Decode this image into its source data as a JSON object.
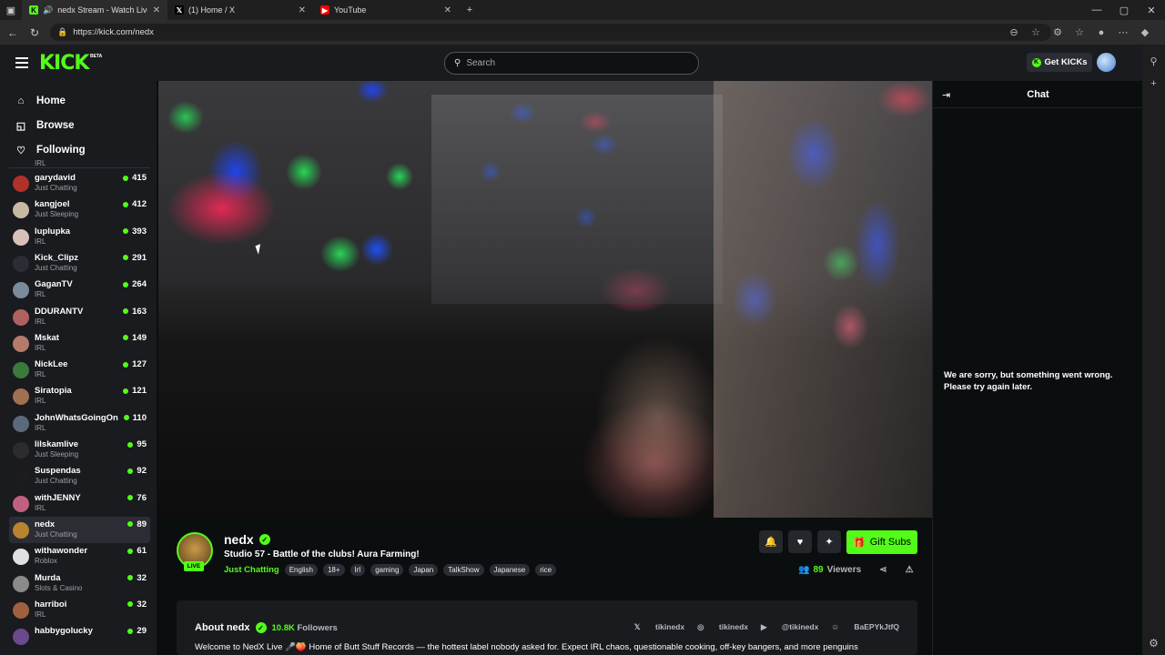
{
  "browser": {
    "tabs": [
      {
        "title": "nedx Stream - Watch Live on Kick",
        "icon": "kick-k"
      },
      {
        "title": "(1) Home / X",
        "icon": "x-logo"
      },
      {
        "title": "YouTube",
        "icon": "youtube-logo"
      }
    ],
    "new_tab": "+",
    "url": "https://kick.com/nedx",
    "window_controls": [
      "—",
      "▢",
      "✕"
    ]
  },
  "header": {
    "logo": "KICK",
    "beta": "BETA",
    "search_placeholder": "Search",
    "get_kicks": "Get KICKs"
  },
  "sidebar": {
    "nav": [
      {
        "label": "Home",
        "icon": "home-icon"
      },
      {
        "label": "Browse",
        "icon": "browse-icon"
      },
      {
        "label": "Following",
        "icon": "heart-icon"
      }
    ],
    "top_partial_category": "IRL",
    "channels": [
      {
        "name": "garydavid",
        "category": "Just Chatting",
        "viewers": "415",
        "color": "#b0302a"
      },
      {
        "name": "kangjoel",
        "category": "Just Sleeping",
        "viewers": "412",
        "color": "#c7b9a4"
      },
      {
        "name": "luplupka",
        "category": "IRL",
        "viewers": "393",
        "color": "#d8c0b8"
      },
      {
        "name": "Kick_Clipz",
        "category": "Just Chatting",
        "viewers": "291",
        "color": "#2a2d33"
      },
      {
        "name": "GaganTV",
        "category": "IRL",
        "viewers": "264",
        "color": "#7a8b9a"
      },
      {
        "name": "DDURANTV",
        "category": "IRL",
        "viewers": "163",
        "color": "#b06060"
      },
      {
        "name": "Mskat",
        "category": "IRL",
        "viewers": "149",
        "color": "#b57a6a"
      },
      {
        "name": "NickLee",
        "category": "IRL",
        "viewers": "127",
        "color": "#3a7a3a"
      },
      {
        "name": "Siratopia",
        "category": "IRL",
        "viewers": "121",
        "color": "#a07050"
      },
      {
        "name": "JohnWhatsGoingOn",
        "category": "IRL",
        "viewers": "110",
        "color": "#5a6a7a"
      },
      {
        "name": "lilskamlive",
        "category": "Just Sleeping",
        "viewers": "95",
        "color": "#2c2c2c"
      },
      {
        "name": "Suspendas",
        "category": "Just Chatting",
        "viewers": "92",
        "color": "#1c1c1c"
      },
      {
        "name": "withJENNY",
        "category": "IRL",
        "viewers": "76",
        "color": "#c06080"
      },
      {
        "name": "nedx",
        "category": "Just Chatting",
        "viewers": "89",
        "color": "#b8842e"
      },
      {
        "name": "withawonder",
        "category": "Roblox",
        "viewers": "61",
        "color": "#e0e0e0"
      },
      {
        "name": "Murda",
        "category": "Slots & Casino",
        "viewers": "32",
        "color": "#8a8a8a"
      },
      {
        "name": "harriboi",
        "category": "IRL",
        "viewers": "32",
        "color": "#a06040"
      },
      {
        "name": "habbygolucky",
        "category": "",
        "viewers": "29",
        "color": "#6a4a8a"
      }
    ],
    "selected_channel": "nedx"
  },
  "stream": {
    "channel_name": "nedx",
    "live_badge": "LIVE",
    "title": "Studio 57 - Battle of the clubs! Aura Farming!",
    "category": "Just Chatting",
    "tags": [
      "English",
      "18+",
      "Irl",
      "gaming",
      "Japan",
      "TalkShow",
      "Japanese",
      "rice"
    ],
    "gift_subs": "Gift Subs",
    "viewer_count": "89",
    "viewers_label": "Viewers"
  },
  "about": {
    "title": "About nedx",
    "followers_count": "10.8K",
    "followers_label": "Followers",
    "socials": [
      "tikinedx",
      "tikinedx",
      "@tikinedx",
      "BaEPYkJtfQ"
    ],
    "description": "Welcome to NedX Live 🎤🍑 Home of Butt Stuff Records — the hottest label nobody asked for. Expect IRL chaos, questionable cooking, off-key bangers, and more penguins"
  },
  "chat": {
    "title": "Chat",
    "error_message": "We are sorry, but something went wrong. Please try again later."
  },
  "colors": {
    "kick_green": "#53fc18",
    "background": "#0b0e0f",
    "panel": "#191b1f"
  }
}
